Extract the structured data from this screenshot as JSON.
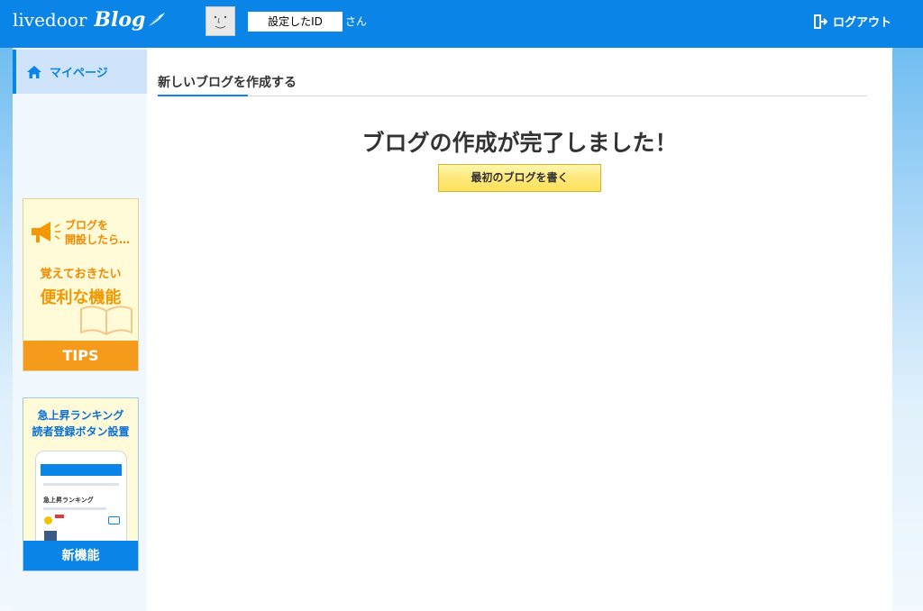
{
  "header": {
    "logo_text": "livedoor",
    "logo_script": "Blog",
    "user_id": "設定したID",
    "user_suffix": "さん",
    "logout_label": "ログアウト"
  },
  "sidebar": {
    "mypage_label": "マイページ",
    "tips_banner": {
      "line1": "ブログを",
      "line2": "開設したら…",
      "line3": "覚えておきたい",
      "line4": "便利な機能",
      "footer": "TIPS"
    },
    "feature_banner": {
      "line1": "急上昇ランキング",
      "line2": "読者登録ボタン設置",
      "phone_title": "急上昇ランキング",
      "footer": "新機能"
    }
  },
  "main": {
    "page_title": "新しいブログを作成する",
    "complete_message": "ブログの作成が完了しました！",
    "write_button": "最初のブログを書く"
  }
}
